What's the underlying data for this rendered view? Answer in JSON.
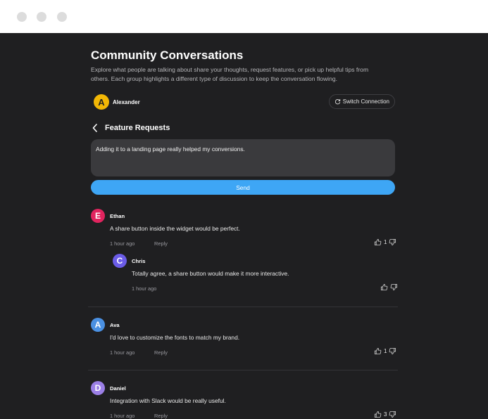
{
  "window": {
    "controls": [
      "close",
      "minimize",
      "maximize"
    ]
  },
  "page": {
    "title": "Community Conversations",
    "description": "Explore what people are talking about share your thoughts, request features, or pick up helpful tips from others. Each group highlights a different type of discussion to keep the conversation flowing."
  },
  "user": {
    "initial": "A",
    "name": "Alexander",
    "avatar_color": "#f2b705"
  },
  "switch_connection": {
    "label": "Switch Connection",
    "icon": "refresh-icon"
  },
  "section": {
    "title": "Feature Requests",
    "back_icon": "chevron-left-icon"
  },
  "composer": {
    "value": "Adding it to a landing page really helped my conversions."
  },
  "send": {
    "label": "Send",
    "color": "#3ea6f5"
  },
  "comments": [
    {
      "initial": "E",
      "name": "Ethan",
      "text": "A share button inside the widget would be perfect.",
      "time": "1 hour ago",
      "reply": "Reply",
      "likes": "1",
      "avatar_color": "#e0245e"
    },
    {
      "initial": "C",
      "name": "Chris",
      "text": "Totally agree, a share button would make it more interactive.",
      "time": "1 hour ago",
      "likes": "",
      "avatar_color": "#6b5ce7"
    },
    {
      "initial": "A",
      "name": "Ava",
      "text": "I'd love to customize the fonts to match my brand.",
      "time": "1 hour ago",
      "reply": "Reply",
      "likes": "1",
      "avatar_color": "#4a90e2"
    },
    {
      "initial": "D",
      "name": "Daniel",
      "text": "Integration with Slack would be really useful.",
      "time": "1 hour ago",
      "reply": "Reply",
      "likes": "3",
      "avatar_color": "#9b7fe6"
    }
  ]
}
